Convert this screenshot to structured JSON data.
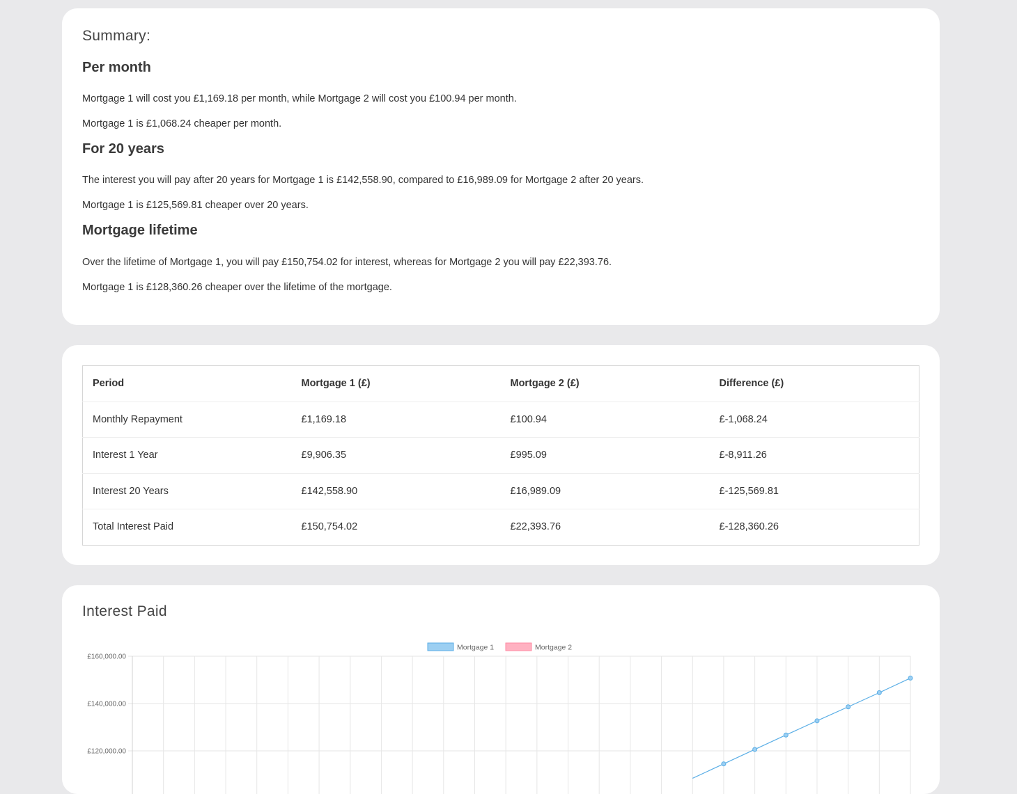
{
  "summary": {
    "title": "Summary:",
    "per_month": {
      "heading": "Per month",
      "line1": "Mortgage 1 will cost you £1,169.18 per month, while Mortgage 2 will cost you £100.94 per month.",
      "line2": "Mortgage 1 is £1,068.24 cheaper per month."
    },
    "for_20_years": {
      "heading": "For 20 years",
      "line1": "The interest you will pay after 20 years for Mortgage 1 is £142,558.90, compared to £16,989.09 for Mortgage 2 after 20 years.",
      "line2": "Mortgage 1 is £125,569.81 cheaper over 20 years."
    },
    "lifetime": {
      "heading": "Mortgage lifetime",
      "line1": "Over the lifetime of Mortgage 1, you will pay £150,754.02 for interest, whereas for Mortgage 2 you will pay £22,393.76.",
      "line2": "Mortgage 1 is £128,360.26 cheaper over the lifetime of the mortgage."
    }
  },
  "table": {
    "headers": [
      "Period",
      "Mortgage 1 (£)",
      "Mortgage 2 (£)",
      "Difference (£)"
    ],
    "rows": [
      [
        "Monthly Repayment",
        "£1,169.18",
        "£100.94",
        "£-1,068.24"
      ],
      [
        "Interest 1 Year",
        "£9,906.35",
        "£995.09",
        "£-8,911.26"
      ],
      [
        "Interest 20 Years",
        "£142,558.90",
        "£16,989.09",
        "£-125,569.81"
      ],
      [
        "Total Interest Paid",
        "£150,754.02",
        "£22,393.76",
        "£-128,360.26"
      ]
    ]
  },
  "chart": {
    "title": "Interest Paid"
  },
  "chart_data": {
    "type": "line",
    "title": "",
    "xlabel": "",
    "ylabel": "",
    "ylim": [
      110000,
      160000
    ],
    "y_ticks": [
      "£160,000.00",
      "£140,000.00",
      "£120,000.00"
    ],
    "y_tick_values": [
      160000,
      140000,
      120000
    ],
    "grid": true,
    "legend_placement": "top-center",
    "series": [
      {
        "name": "Mortgage 1",
        "color": "#5aaee6",
        "fill": "#9ccff2",
        "points": [
          {
            "x": 19,
            "y": 114500
          },
          {
            "x": 20,
            "y": 120600
          },
          {
            "x": 21,
            "y": 126700
          },
          {
            "x": 22,
            "y": 132700
          },
          {
            "x": 23,
            "y": 138600
          },
          {
            "x": 24,
            "y": 144600
          },
          {
            "x": 25,
            "y": 150754
          }
        ]
      },
      {
        "name": "Mortgage 2",
        "color": "#ff8aa3",
        "fill": "#ffb1c1",
        "points": []
      }
    ],
    "x_count": 26
  }
}
